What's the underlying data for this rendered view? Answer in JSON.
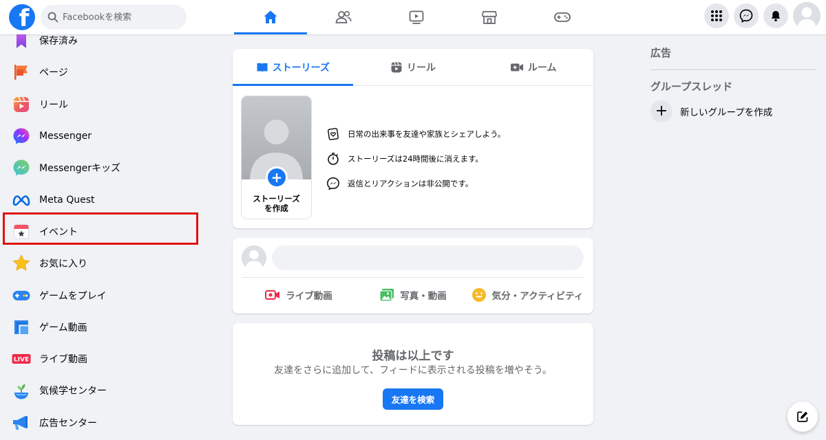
{
  "search": {
    "placeholder": "Facebookを検索"
  },
  "nav_tabs": [
    {
      "icon": "home-icon"
    },
    {
      "icon": "friends-icon"
    },
    {
      "icon": "watch-icon"
    },
    {
      "icon": "marketplace-icon"
    },
    {
      "icon": "gaming-icon"
    }
  ],
  "top_right": [
    "menu-grid-icon",
    "messenger-icon",
    "notifications-icon",
    "profile-avatar"
  ],
  "sidebar": {
    "items": [
      {
        "label": "保存済み",
        "icon": "saved-icon"
      },
      {
        "label": "ページ",
        "icon": "pages-icon"
      },
      {
        "label": "リール",
        "icon": "reels-icon"
      },
      {
        "label": "Messenger",
        "icon": "messenger-icon"
      },
      {
        "label": "Messengerキッズ",
        "icon": "messenger-kids-icon"
      },
      {
        "label": "Meta Quest",
        "icon": "meta-quest-icon"
      },
      {
        "label": "イベント",
        "icon": "events-icon"
      },
      {
        "label": "お気に入り",
        "icon": "favorites-icon"
      },
      {
        "label": "ゲームをプレイ",
        "icon": "play-games-icon"
      },
      {
        "label": "ゲーム動画",
        "icon": "gaming-video-icon"
      },
      {
        "label": "ライブ動画",
        "icon": "live-video-icon"
      },
      {
        "label": "気候学センター",
        "icon": "climate-center-icon"
      },
      {
        "label": "広告センター",
        "icon": "ad-center-icon"
      }
    ],
    "live_badge": "LIVE"
  },
  "stories": {
    "tabs": [
      "ストーリーズ",
      "リール",
      "ルーム"
    ],
    "create_line1": "ストーリーズ",
    "create_line2": "を作成",
    "info": [
      "日常の出来事を友達や家族とシェアしよう。",
      "ストーリーズは24時間後に消えます。",
      "返信とリアクションは非公開です。"
    ]
  },
  "composer": {
    "actions": [
      "ライブ動画",
      "写真・動画",
      "気分・アクティビティ"
    ]
  },
  "end_of_feed": {
    "title": "投稿は以上です",
    "subtitle": "友達をさらに追加して、フィードに表示される投稿を増やそう。",
    "button": "友達を検索"
  },
  "right_col": {
    "ads_heading": "広告",
    "groups_heading": "グループスレッド",
    "new_group": "新しいグループを作成"
  },
  "colors": {
    "brand": "#1877f2",
    "highlight": "#e01010"
  }
}
